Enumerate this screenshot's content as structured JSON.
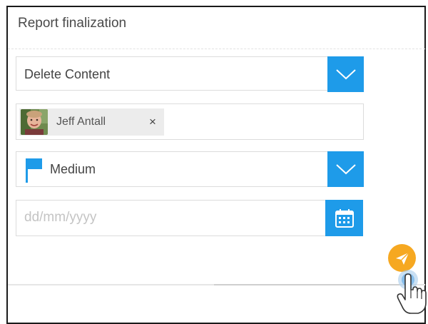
{
  "panel": {
    "title": "Report finalization"
  },
  "action_select": {
    "value": "Delete Content",
    "icon": "chevron-down-icon"
  },
  "assignee": {
    "name": "Jeff Antall",
    "remove_label": "×",
    "avatar_icon": "user-avatar"
  },
  "priority_select": {
    "value": "Medium",
    "flag_icon": "flag-icon",
    "flag_color": "#1e9be9",
    "icon": "chevron-down-icon"
  },
  "due_date": {
    "placeholder": "dd/mm/yyyy",
    "value": "",
    "icon": "calendar-icon"
  },
  "send": {
    "icon": "paper-plane-icon",
    "color": "#f6a821"
  },
  "colors": {
    "accent": "#1e9be9",
    "send": "#f6a821"
  }
}
